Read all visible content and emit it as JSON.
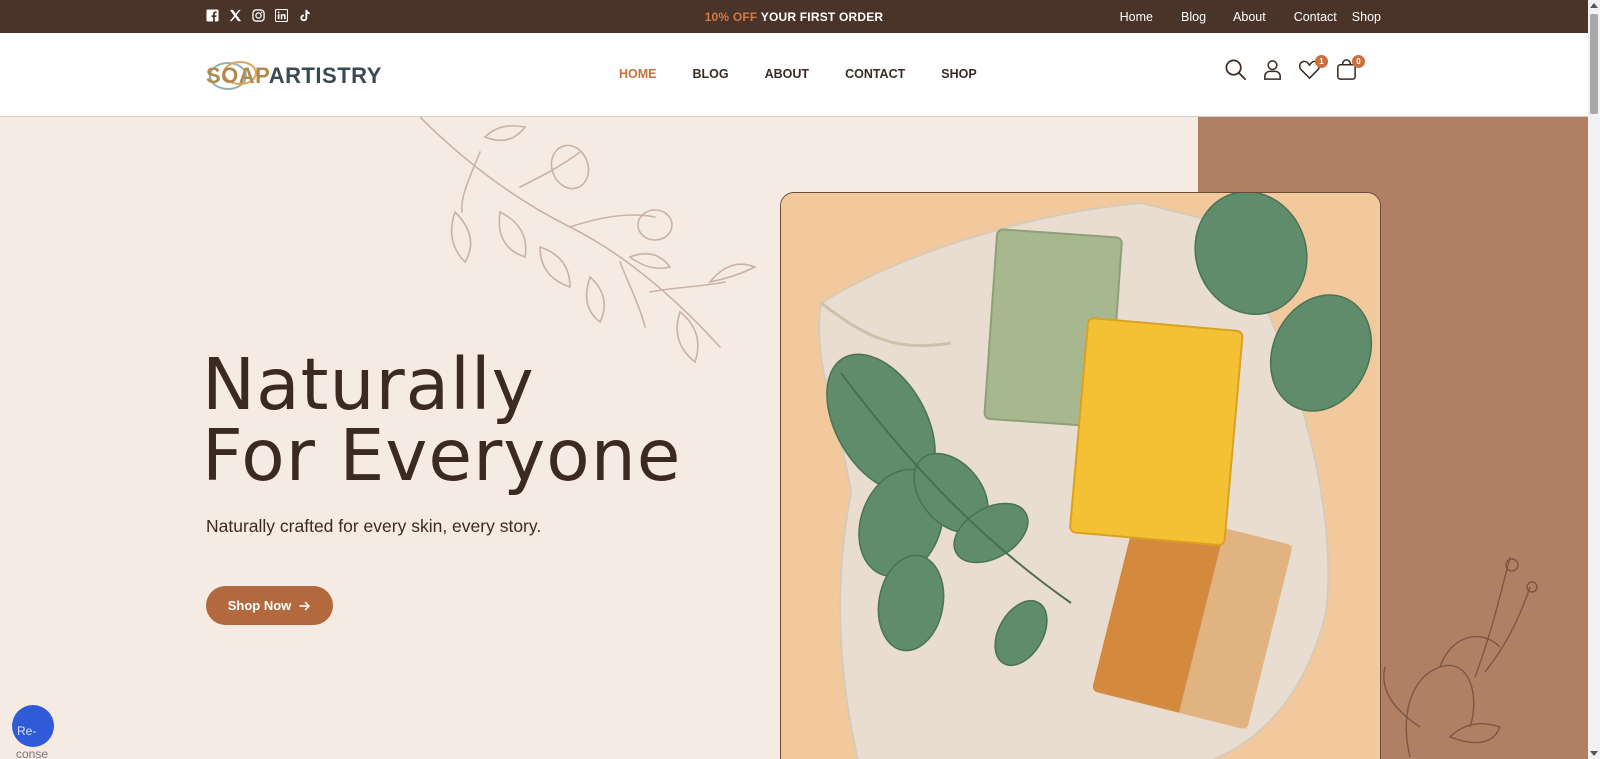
{
  "topbar": {
    "social_icons": [
      "facebook-icon",
      "x-icon",
      "instagram-icon",
      "linkedin-icon",
      "tiktok-icon"
    ],
    "promo_accent": "10% OFF",
    "promo_text": " YOUR FIRST ORDER",
    "links": [
      "Home",
      "Blog",
      "About",
      "Contact",
      "Shop"
    ]
  },
  "header": {
    "logo_part1": "SOAP",
    "logo_part2": "ARTISTRY",
    "nav": [
      "HOME",
      "BLOG",
      "ABOUT",
      "CONTACT",
      "SHOP"
    ],
    "active_nav": "HOME",
    "icons": [
      "search-icon",
      "user-icon",
      "heart-icon",
      "bag-icon"
    ],
    "wishlist_count": "1",
    "cart_count": "0"
  },
  "hero": {
    "title_line1": "Naturally",
    "title_line2": "For Everyone",
    "subtitle": "Naturally crafted for every skin, every story.",
    "button_label": "Shop Now"
  },
  "widget": {
    "alt_text": "Re-",
    "below_text": "conse"
  },
  "colors": {
    "topbar_bg": "#4a3329",
    "accent": "#c6713f",
    "hero_bg": "#f6ebe2",
    "hero_panel": "#b17f63",
    "button": "#b2693d",
    "text_dark": "#3b2a21"
  }
}
